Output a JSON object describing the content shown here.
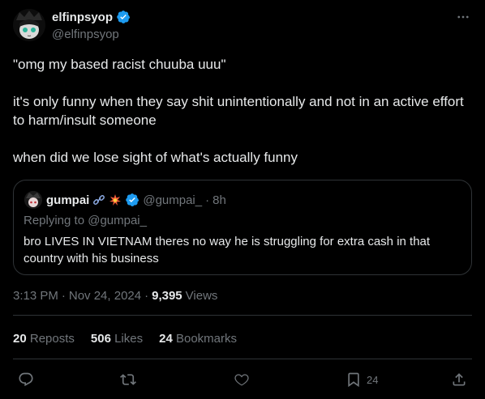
{
  "author": {
    "display_name": "elfinpsyop",
    "handle": "@elfinpsyop",
    "verified": true
  },
  "tweet_text": "\"omg my based racist chuuba uuu\"\n\nit's only funny when they say shit unintentionally and not in an active effort to harm/insult someone\n\nwhen did we lose sight of what's actually funny",
  "quote": {
    "display_name": "gumpai",
    "handle": "@gumpai_",
    "separator": "·",
    "time": "8h",
    "replying_to": "Replying to @gumpai_",
    "text": "bro LIVES IN VIETNAM theres no way he is struggling for extra cash in that country with his business"
  },
  "meta": {
    "time": "3:13 PM",
    "sep1": "·",
    "date": "Nov 24, 2024",
    "sep2": "·",
    "views_count": "9,395",
    "views_label": "Views"
  },
  "stats": {
    "reposts_count": "20",
    "reposts_label": "Reposts",
    "likes_count": "506",
    "likes_label": "Likes",
    "bookmarks_count": "24",
    "bookmarks_label": "Bookmarks"
  },
  "actions": {
    "bookmark_count": "24"
  },
  "colors": {
    "background": "#000000",
    "text": "#e7e9ea",
    "muted": "#71767b",
    "border": "#2f3336",
    "verified": "#1d9bf0"
  }
}
